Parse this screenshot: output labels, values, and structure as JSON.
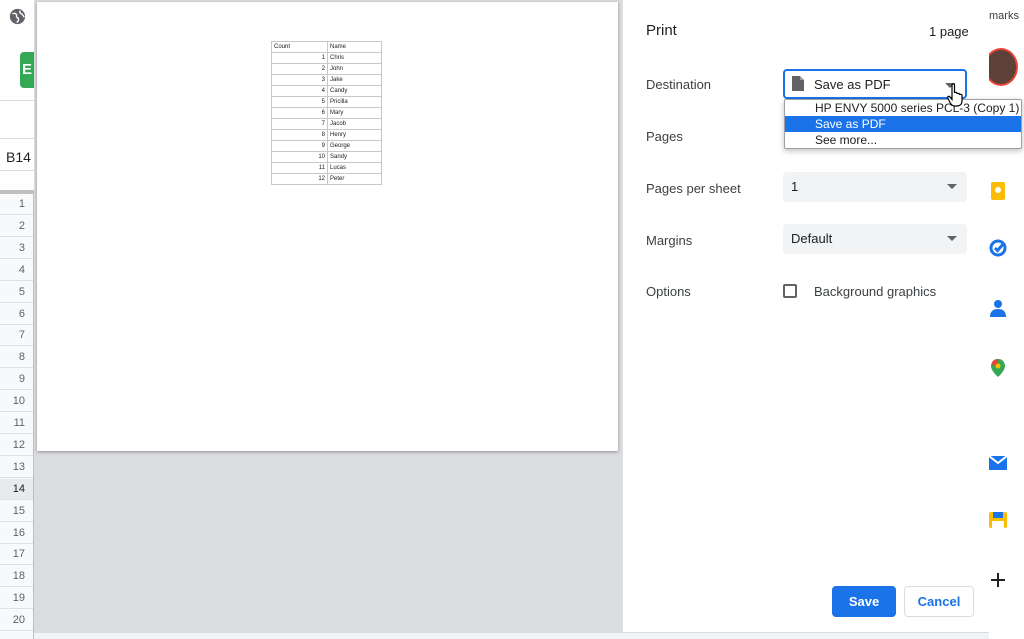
{
  "background_app": {
    "logo_letter": "E",
    "cell_reference": "B14",
    "row_numbers": [
      "1",
      "2",
      "3",
      "4",
      "5",
      "6",
      "7",
      "8",
      "9",
      "10",
      "11",
      "12",
      "13",
      "14",
      "15",
      "16",
      "17",
      "18",
      "19",
      "20"
    ],
    "selected_row": "14",
    "bookmarks_label": "marks"
  },
  "print_dialog": {
    "title": "Print",
    "page_count": "1 page",
    "destination": {
      "label": "Destination",
      "value": "Save as PDF",
      "options": [
        "HP ENVY 5000 series PCL-3 (Copy 1)",
        "Save as PDF",
        "See more..."
      ],
      "selected_option": "Save as PDF"
    },
    "pages": {
      "label": "Pages"
    },
    "pages_per_sheet": {
      "label": "Pages per sheet",
      "value": "1"
    },
    "margins": {
      "label": "Margins",
      "value": "Default"
    },
    "options": {
      "label": "Options",
      "background_graphics": "Background graphics",
      "checked": false
    },
    "save_label": "Save",
    "cancel_label": "Cancel"
  },
  "preview": {
    "headers": [
      "Count",
      "Name"
    ],
    "rows": [
      [
        "1",
        "Chris"
      ],
      [
        "2",
        "John"
      ],
      [
        "3",
        "Jake"
      ],
      [
        "4",
        "Candy"
      ],
      [
        "5",
        "Pricilla"
      ],
      [
        "6",
        "Mary"
      ],
      [
        "7",
        "Jacob"
      ],
      [
        "8",
        "Henry"
      ],
      [
        "9",
        "George"
      ],
      [
        "10",
        "Sandy"
      ],
      [
        "11",
        "Lucas"
      ],
      [
        "12",
        "Peter"
      ]
    ]
  },
  "colors": {
    "accent": "#1a73e8",
    "preview_background": "#dadce0"
  }
}
